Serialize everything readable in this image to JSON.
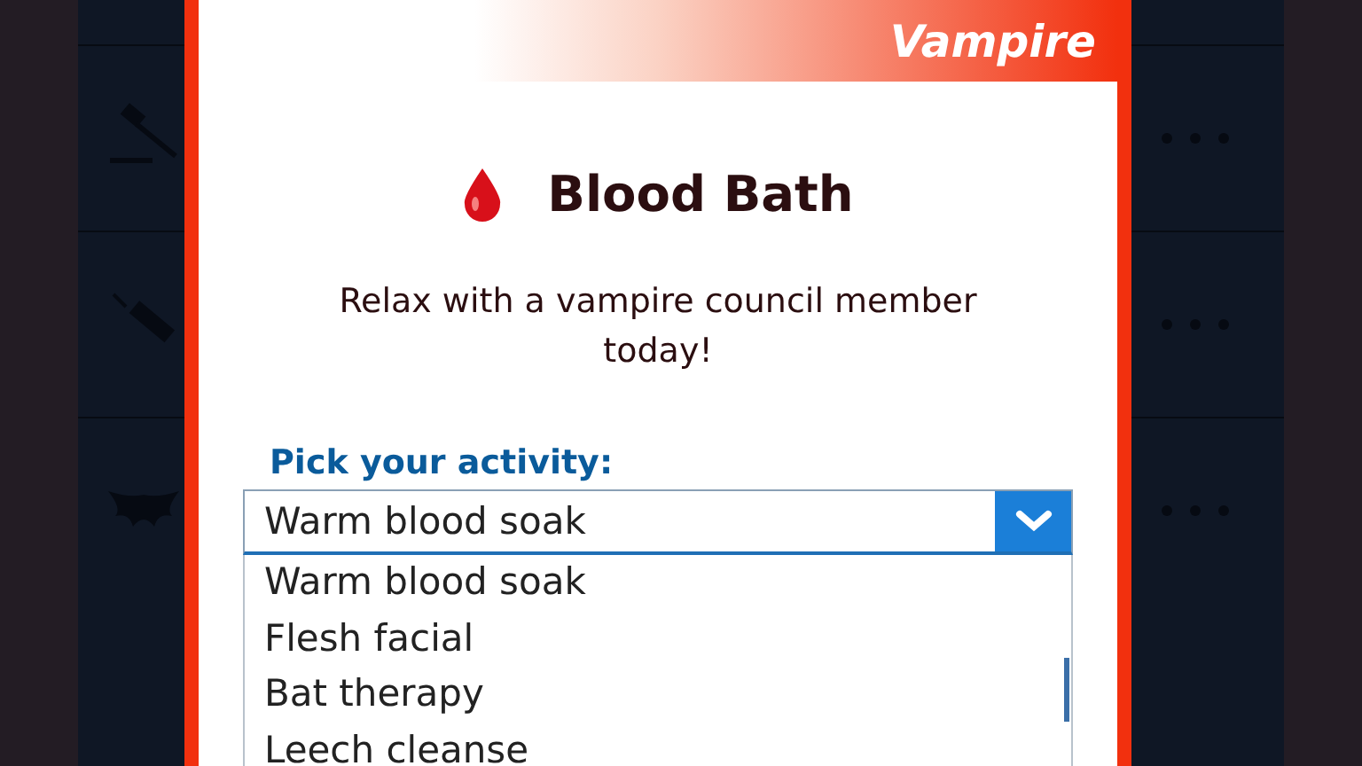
{
  "background_rows": [
    {
      "kind": "gavel"
    },
    {
      "kind": "syringe"
    },
    {
      "kind": "bat"
    }
  ],
  "modal": {
    "category": "Vampire",
    "title": "Blood Bath",
    "description": "Relax with a vampire council member today!",
    "field_label": "Pick your activity:",
    "select": {
      "value": "Warm blood soak",
      "expanded": true,
      "options": [
        "Warm blood soak",
        "Flesh facial",
        "Bat therapy",
        "Leech cleanse"
      ]
    }
  }
}
